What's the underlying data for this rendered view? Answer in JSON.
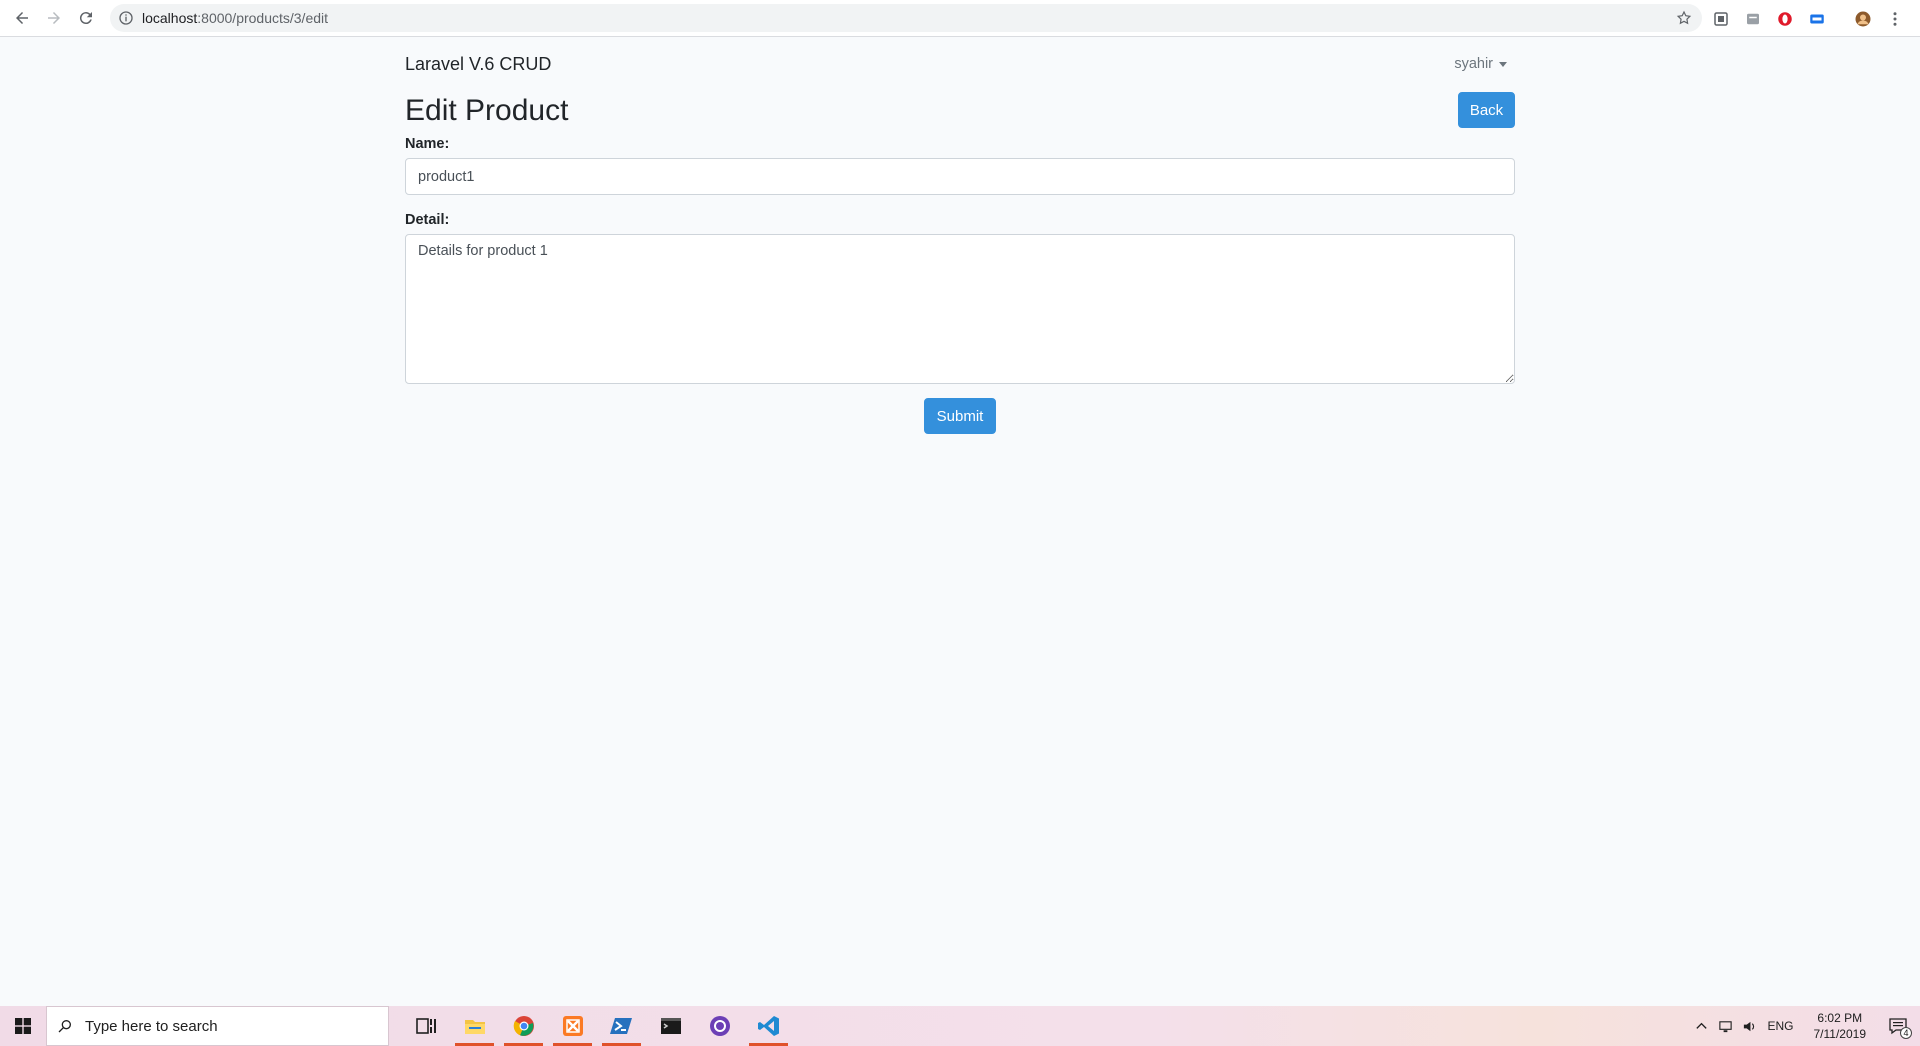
{
  "browser": {
    "url_host": "localhost",
    "url_path": ":8000/products/3/edit",
    "icons": [
      "back-arrow-icon",
      "forward-arrow-icon",
      "reload-icon",
      "info-icon",
      "bookmark-star-icon",
      "extension-icon",
      "menu-dots-icon"
    ]
  },
  "navbar": {
    "brand": "Laravel V.6 CRUD",
    "user": "syahir"
  },
  "header": {
    "title": "Edit Product",
    "back_label": "Back"
  },
  "form": {
    "name_label": "Name:",
    "name_value": "product1",
    "detail_label": "Detail:",
    "detail_value": "Details for product 1",
    "submit_label": "Submit"
  },
  "taskbar": {
    "search_placeholder": "Type here to search",
    "language": "ENG",
    "time": "6:02 PM",
    "date": "7/11/2019",
    "notification_count": "4"
  },
  "colors": {
    "primary": "#3490dc",
    "page_bg": "#f8fafc"
  }
}
